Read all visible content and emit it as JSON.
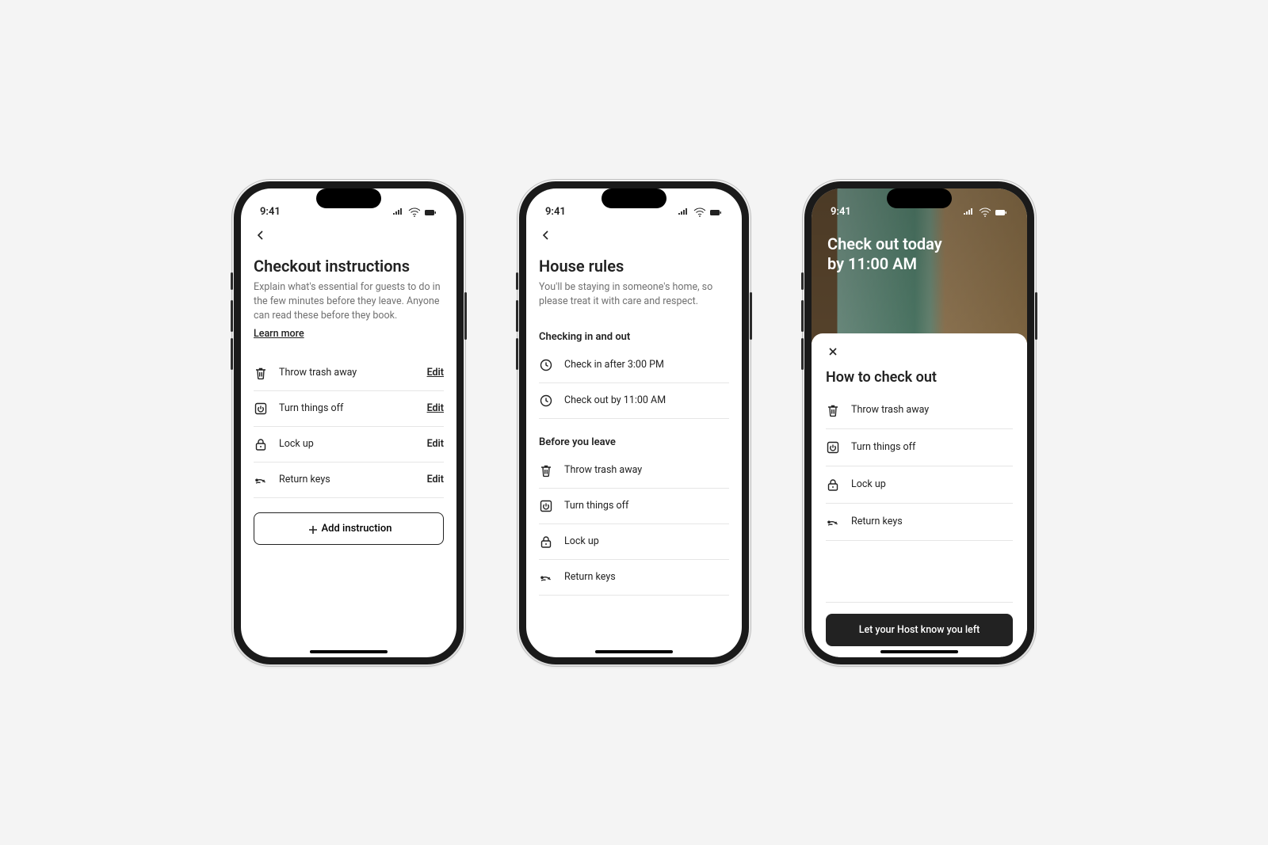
{
  "status_time": "9:41",
  "phone1": {
    "title": "Checkout instructions",
    "subtitle": "Explain what's essential for guests to do in the few minutes before they leave. Anyone can read these before they book.",
    "learn_more": "Learn more",
    "items": [
      {
        "icon": "trash-icon",
        "label": "Throw trash away",
        "action": "Edit",
        "action_underlined": true
      },
      {
        "icon": "power-icon",
        "label": "Turn things off",
        "action": "Edit",
        "action_underlined": true
      },
      {
        "icon": "lock-icon",
        "label": "Lock up",
        "action": "Edit",
        "action_underlined": false
      },
      {
        "icon": "keys-icon",
        "label": "Return keys",
        "action": "Edit",
        "action_underlined": false
      }
    ],
    "add_button": "Add instruction"
  },
  "phone2": {
    "title": "House rules",
    "subtitle": "You'll be staying in someone's home, so please treat it with care and respect.",
    "section1_label": "Checking in and out",
    "section1_items": [
      {
        "icon": "clock-icon",
        "label": "Check in after 3:00 PM"
      },
      {
        "icon": "clock-icon",
        "label": "Check out by 11:00 AM"
      }
    ],
    "section2_label": "Before you leave",
    "section2_items": [
      {
        "icon": "trash-icon",
        "label": "Throw trash away"
      },
      {
        "icon": "power-icon",
        "label": "Turn things off"
      },
      {
        "icon": "lock-icon",
        "label": "Lock up"
      },
      {
        "icon": "keys-icon",
        "label": "Return keys"
      }
    ]
  },
  "phone3": {
    "hero_line1": "Check out today",
    "hero_line2": "by 11:00 AM",
    "sheet_title": "How to check out",
    "items": [
      {
        "icon": "trash-icon",
        "label": "Throw trash away"
      },
      {
        "icon": "power-icon",
        "label": "Turn things off"
      },
      {
        "icon": "lock-icon",
        "label": "Lock up"
      },
      {
        "icon": "keys-icon",
        "label": "Return keys"
      }
    ],
    "cta": "Let your Host know you left"
  }
}
